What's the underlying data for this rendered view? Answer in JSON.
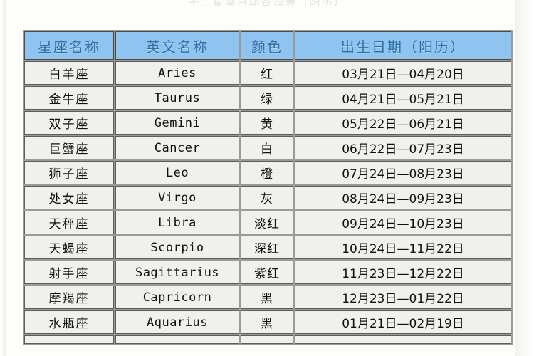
{
  "page": {
    "cropped_top_title": "十二星座日期查询表（阳历）"
  },
  "table": {
    "headers": {
      "name": "星座名称",
      "english": "英文名称",
      "color": "颜色",
      "date": "出生日期（阳历）"
    },
    "colors": {
      "header_background": "#8FC4F0",
      "header_text": "#2F6FA8",
      "cell_background": "#F0F0EC",
      "cell_text": "#111111",
      "grid_line": "#5D5D5A",
      "page_background": "#FDFDFC"
    },
    "rows": [
      {
        "name": "白羊座",
        "english": "Aries",
        "color": "红",
        "date": "03月21日—04月20日"
      },
      {
        "name": "金牛座",
        "english": "Taurus",
        "color": "绿",
        "date": "04月21日—05月21日"
      },
      {
        "name": "双子座",
        "english": "Gemini",
        "color": "黄",
        "date": "05月22日—06月21日"
      },
      {
        "name": "巨蟹座",
        "english": "Cancer",
        "color": "白",
        "date": "06月22日—07月23日"
      },
      {
        "name": "狮子座",
        "english": "Leo",
        "color": "橙",
        "date": "07月24日—08月23日"
      },
      {
        "name": "处女座",
        "english": "Virgo",
        "color": "灰",
        "date": "08月24日—09月23日"
      },
      {
        "name": "天秤座",
        "english": "Libra",
        "color": "淡红",
        "date": "09月24日—10月23日"
      },
      {
        "name": "天蝎座",
        "english": "Scorpio",
        "color": "深红",
        "date": "10月24日—11月22日"
      },
      {
        "name": "射手座",
        "english": "Sagittarius",
        "color": "紫红",
        "date": "11月23日—12月22日"
      },
      {
        "name": "摩羯座",
        "english": "Capricorn",
        "color": "黑",
        "date": "12月23日—01月22日"
      },
      {
        "name": "水瓶座",
        "english": "Aquarius",
        "color": "黑",
        "date": "01月21日—02月19日"
      }
    ],
    "clipped_row": {
      "name": "",
      "english": "",
      "color": "",
      "date": ""
    }
  }
}
